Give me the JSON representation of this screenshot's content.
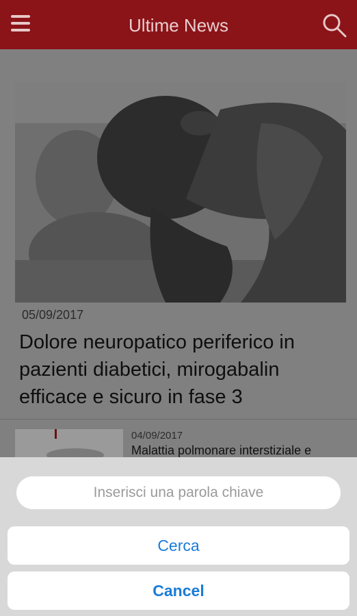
{
  "header": {
    "title": "Ultime News",
    "menu_icon": "hamburger-menu-icon",
    "search_icon": "search-icon",
    "bg_color": "#8b1418"
  },
  "hero": {
    "date": "05/09/2017",
    "title": "Dolore neuropatico periferico in pazienti diabetici, mirogabalin efficace e sicuro in fase 3"
  },
  "list": [
    {
      "date": "04/09/2017",
      "title": "Malattia polmonare interstiziale e"
    }
  ],
  "search_sheet": {
    "placeholder": "Inserisci una parola chiave",
    "search_label": "Cerca",
    "cancel_label": "Cancel",
    "accent_color": "#1a7bd8"
  }
}
